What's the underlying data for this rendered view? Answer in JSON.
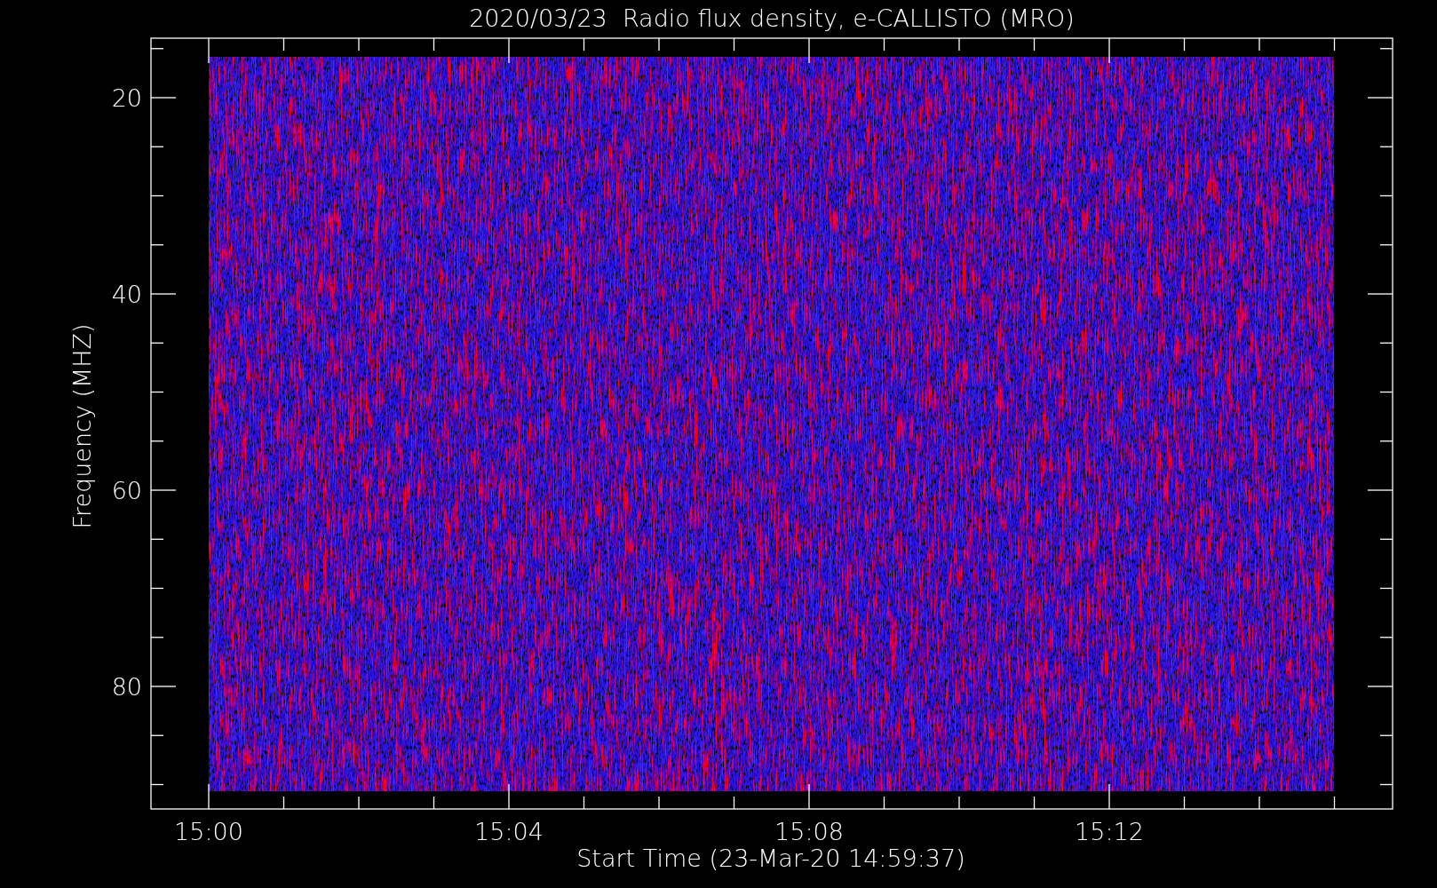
{
  "plot": {
    "title": "2020/03/23  Radio flux density, e-CALLISTO (MRO)",
    "xlabel": "Start Time (23-Mar-20 14:59:37)",
    "ylabel": "Frequency (MHZ)",
    "yticks": [
      "20",
      "40",
      "60",
      "80"
    ],
    "xticks": [
      "15:00",
      "15:04",
      "15:08",
      "15:12"
    ]
  }
}
